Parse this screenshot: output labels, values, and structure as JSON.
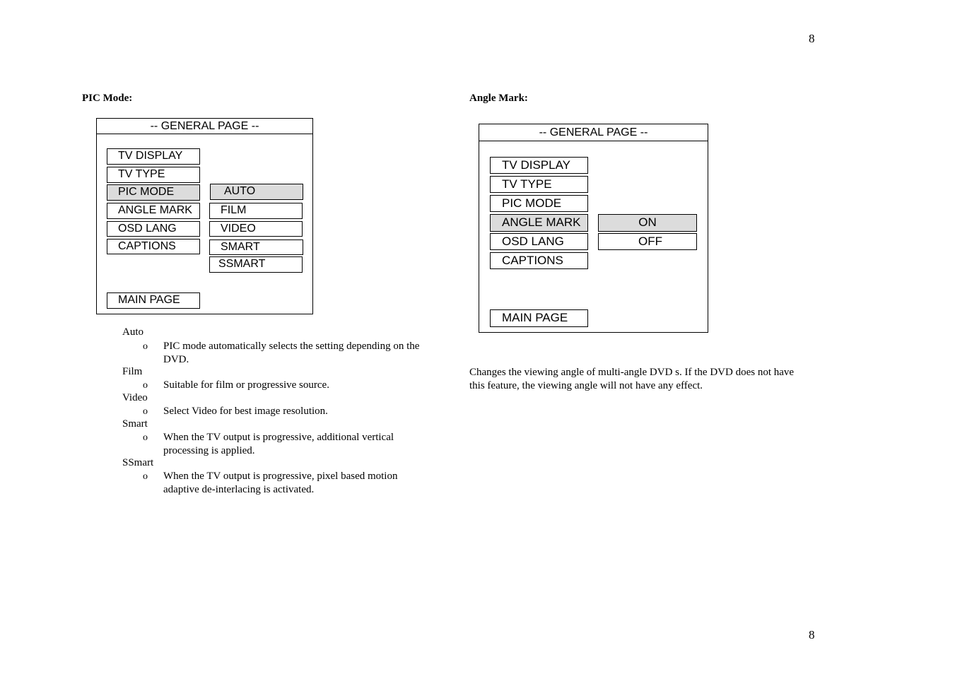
{
  "page_number_top": "8",
  "page_number_bottom": "8",
  "pic_mode": {
    "heading": "PIC Mode:",
    "menu": {
      "title": "--  GENERAL  PAGE  --",
      "items": [
        "TV DISPLAY",
        "TV TYPE",
        "PIC MODE",
        "ANGLE MARK",
        "OSD LANG",
        "CAPTIONS"
      ],
      "selected_item": "PIC MODE",
      "options": [
        "AUTO",
        "FILM",
        "VIDEO",
        "SMART",
        "SSMART"
      ],
      "selected_option": "AUTO",
      "main_page": "MAIN PAGE"
    },
    "descriptions": [
      {
        "term": "Auto",
        "bullet": "o",
        "text": "PIC mode automatically selects the setting depending on the DVD."
      },
      {
        "term": "Film",
        "bullet": "o",
        "text": "Suitable for film or progressive source."
      },
      {
        "term": "Video",
        "bullet": "o",
        "text": "Select Video for best image resolution."
      },
      {
        "term": "Smart",
        "bullet": "o",
        "text": "When the TV output is progressive, additional vertical processing is applied."
      },
      {
        "term": "SSmart",
        "bullet": "o",
        "text": "When the TV output is progressive, pixel based motion adaptive de-interlacing is activated."
      }
    ]
  },
  "angle_mark": {
    "heading": "Angle Mark:",
    "menu": {
      "title": "--  GENERAL  PAGE  --",
      "items": [
        "TV DISPLAY",
        "TV TYPE",
        "PIC MODE",
        "ANGLE MARK",
        "OSD LANG",
        "CAPTIONS"
      ],
      "selected_item": "ANGLE MARK",
      "options": [
        "ON",
        "OFF"
      ],
      "selected_option": "ON",
      "main_page": "MAIN PAGE"
    },
    "description": "Changes the viewing angle of multi-angle DVD s.  If the DVD does not have this feature, the viewing angle will not have any effect."
  }
}
